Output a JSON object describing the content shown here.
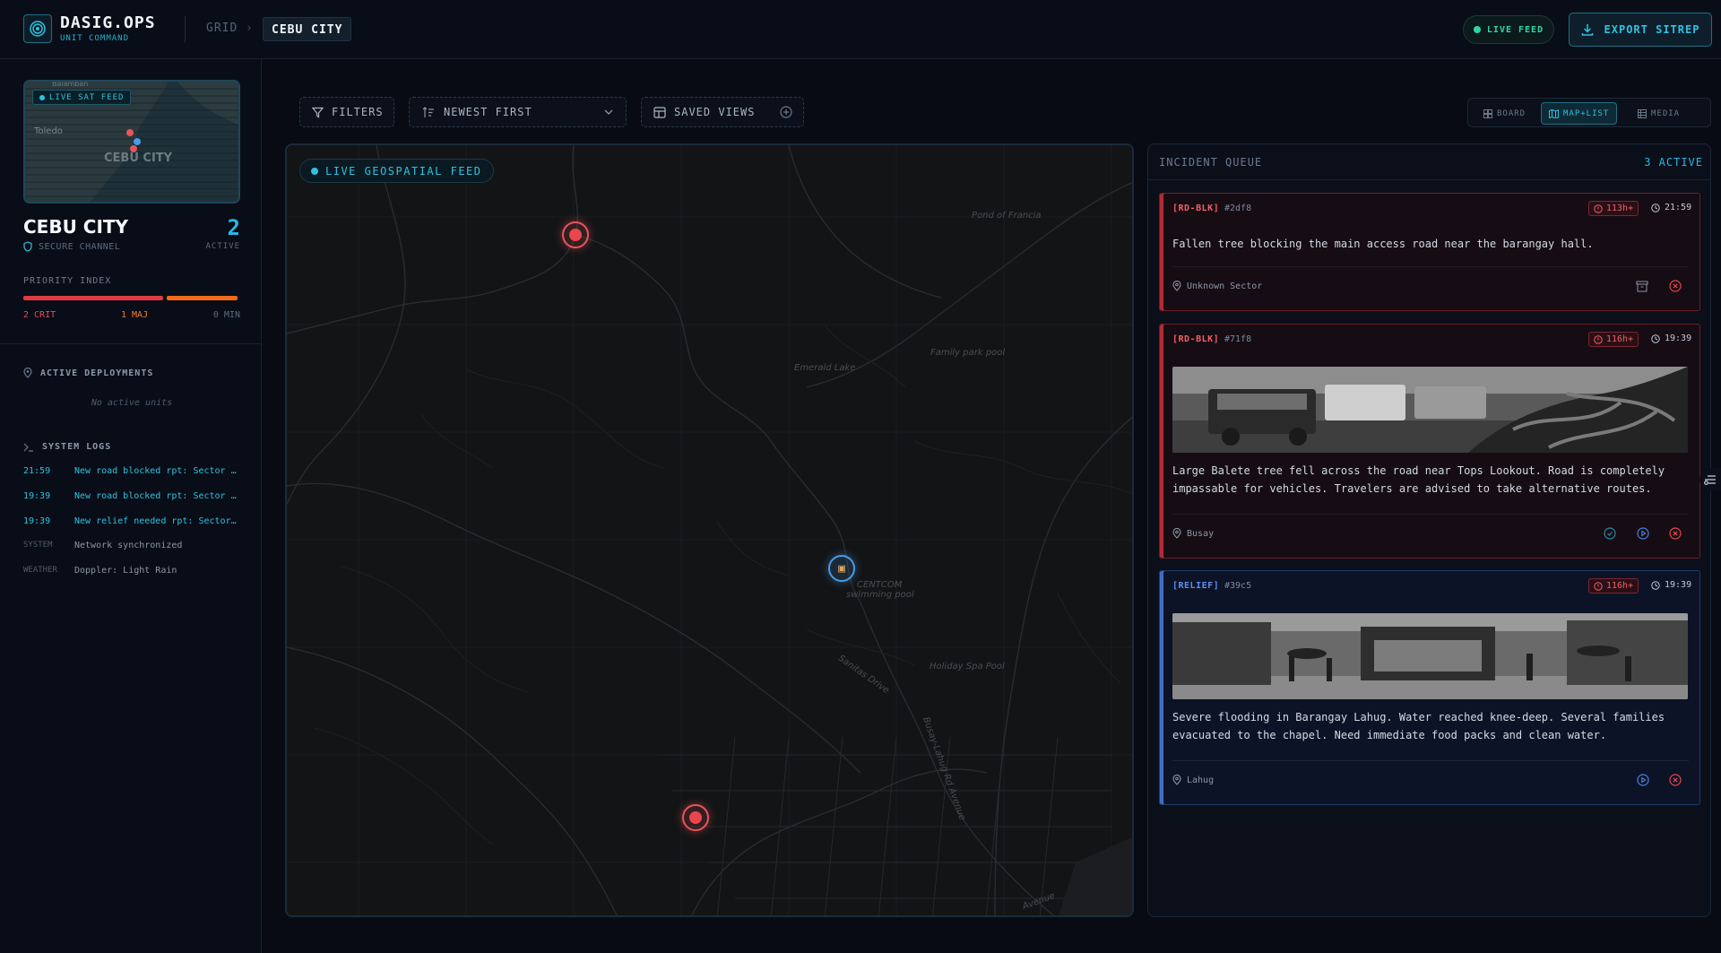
{
  "app": {
    "name": "DASIG.OPS",
    "subtitle": "UNIT COMMAND"
  },
  "breadcrumb": {
    "root": "GRID",
    "separator": "›",
    "current": "CEBU CITY"
  },
  "header": {
    "live_label": "LIVE FEED",
    "export_label": "EXPORT SITREP"
  },
  "sidebar": {
    "minimap": {
      "badge": "LIVE SAT FEED",
      "labels": [
        "Toledo",
        "CEBU CITY",
        "Balamban"
      ]
    },
    "city": "CEBU CITY",
    "secure": "SECURE CHANNEL",
    "active_count": "2",
    "active_label": "ACTIVE",
    "priority_title": "PRIORITY INDEX",
    "priority": {
      "crit": "2 CRIT",
      "maj": "1 MAJ",
      "min": "0 MIN"
    },
    "deployments_title": "ACTIVE DEPLOYMENTS",
    "no_units": "No active units",
    "logs_title": "SYSTEM LOGS",
    "logs": [
      {
        "time": "21:59",
        "msg": "New road blocked rpt: Sector …"
      },
      {
        "time": "19:39",
        "msg": "New road blocked rpt: Sector …"
      },
      {
        "time": "19:39",
        "msg": "New relief needed rpt: Sector…"
      },
      {
        "time": "SYSTEM",
        "msg": "Network synchronized"
      },
      {
        "time": "WEATHER",
        "msg": "Doppler: Light Rain"
      }
    ]
  },
  "toolbar": {
    "filters": "FILTERS",
    "sort": "NEWEST FIRST",
    "saved_views": "SAVED VIEWS",
    "views": [
      "BOARD",
      "MAP+LIST",
      "MEDIA"
    ],
    "active_view": "MAP+LIST"
  },
  "map": {
    "badge": "LIVE GEOSPATIAL FEED",
    "labels": [
      "Pond of Francia",
      "Emerald Lake",
      "Family park pool",
      "CENTCOM",
      "swimming pool",
      "Holiday Spa Pool",
      "Sanitas Drive",
      "Busay-Lahug Rd Avenue",
      "Avenue"
    ]
  },
  "queue": {
    "title": "INCIDENT QUEUE",
    "count": "3 ACTIVE",
    "incidents": [
      {
        "tag": "[RD-BLK]",
        "id": "#2df8",
        "age": "113h+",
        "time": "21:59",
        "desc": "Fallen tree blocking the main access road near the barangay hall.",
        "location": "Unknown Sector",
        "kind": "red"
      },
      {
        "tag": "[RD-BLK]",
        "id": "#71f8",
        "age": "116h+",
        "time": "19:39",
        "desc": "Large Balete tree fell across the road near Tops Lookout. Road is completely impassable for vehicles. Travelers are advised to take alternative routes.",
        "location": "Busay",
        "kind": "red"
      },
      {
        "tag": "[RELIEF]",
        "id": "#39c5",
        "age": "116h+",
        "time": "19:39",
        "desc": "Severe flooding in Barangay Lahug. Water reached knee-deep. Several families evacuated to the chapel. Need immediate food packs and clean water.",
        "location": "Lahug",
        "kind": "blue"
      }
    ]
  },
  "colors": {
    "accent": "#27b8e4",
    "critical": "#e23a43",
    "major": "#f26a1c",
    "relief": "#3c6fc4",
    "live": "#2fd6a2"
  }
}
